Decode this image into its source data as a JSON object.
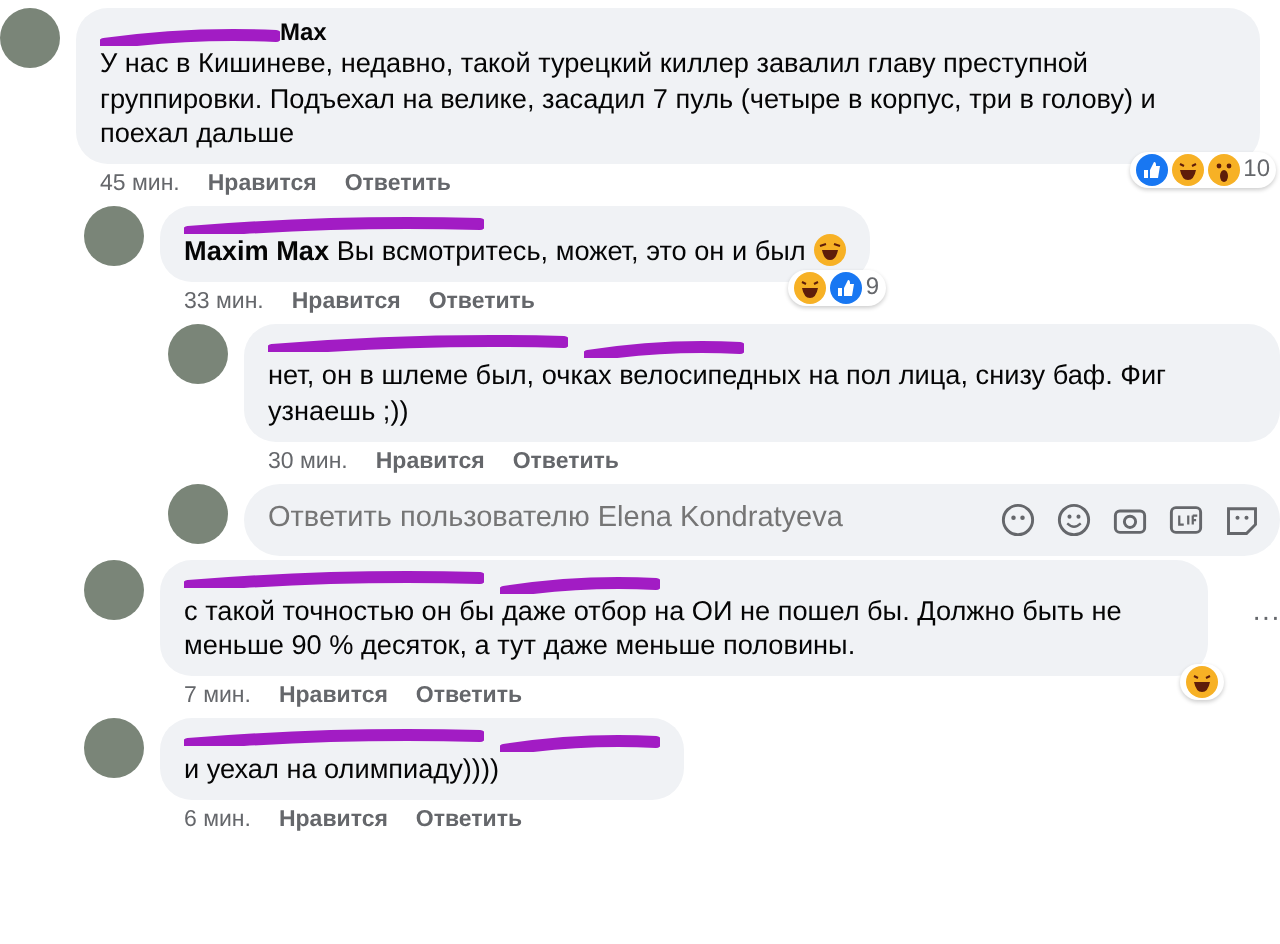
{
  "comments": [
    {
      "author_visible": "Max",
      "text": "У нас в Кишиневе, недавно, такой турецкий киллер завалил главу преступной группировки. Подъехал на велике, засадил 7 пуль (четыре в корпус, три в голову) и поехал дальше",
      "reactions": [
        {
          "kind": "like"
        },
        {
          "kind": "haha"
        },
        {
          "kind": "wow"
        }
      ],
      "reaction_count": "10",
      "time": "45 мин.",
      "like": "Нравится",
      "reply": "Ответить",
      "children": [
        {
          "redacted": true,
          "mention": "Maxim Max",
          "text": "Вы всмотритесь, может, это он и был",
          "emoji": {
            "kind": "laugh"
          },
          "reactions": [
            {
              "kind": "haha"
            },
            {
              "kind": "like"
            }
          ],
          "reaction_count": "9",
          "time": "33 мин.",
          "like": "Нравится",
          "reply": "Ответить",
          "children": [
            {
              "redacted": true,
              "mention_redacted": true,
              "text": "нет, он в шлеме был, очках велосипедных на пол лица, снизу баф. Фиг узнаешь ;))",
              "time": "30 мин.",
              "like": "Нравится",
              "reply": "Ответить"
            }
          ],
          "reply_field": {
            "placeholder": "Ответить пользователю Elena Kondratyeva"
          }
        },
        {
          "redacted": true,
          "mention_redacted": true,
          "text": "с такой точностью он бы даже отбор на ОИ не пошел бы. Должно быть не меньше 90 % десяток, а тут даже меньше половины.",
          "reactions": [
            {
              "kind": "haha"
            }
          ],
          "menu": "···",
          "time": "7 мин.",
          "like": "Нравится",
          "reply": "Ответить"
        },
        {
          "redacted": true,
          "mention_redacted": true,
          "text": "и уехал на олимпиаду))))",
          "time": "6 мин.",
          "like": "Нравится",
          "reply": "Ответить"
        }
      ]
    }
  ]
}
